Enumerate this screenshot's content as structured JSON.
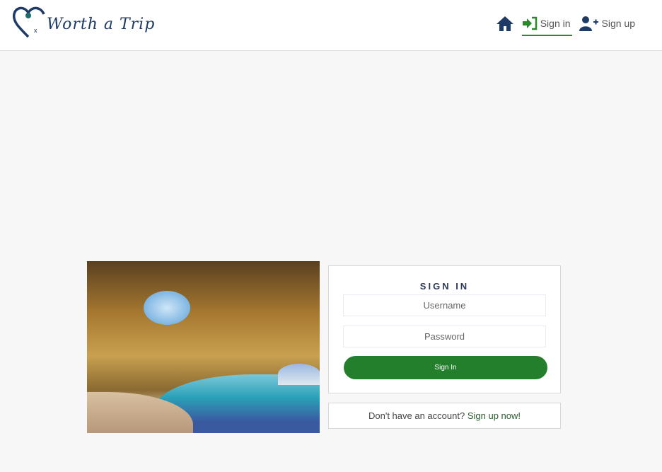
{
  "header": {
    "logo_text": "Worth a Trip",
    "nav": {
      "home_icon": "home-icon",
      "signin": "Sign in",
      "signup": "Sign up"
    }
  },
  "colors": {
    "brand": "#1e3a66",
    "accent": "#247f2c"
  },
  "signin": {
    "title": "SIGN IN",
    "username_placeholder": "Username",
    "password_placeholder": "Password",
    "button": "Sign In"
  },
  "signup_prompt": {
    "text": "Don't have an account?",
    "link": "Sign up now!"
  }
}
